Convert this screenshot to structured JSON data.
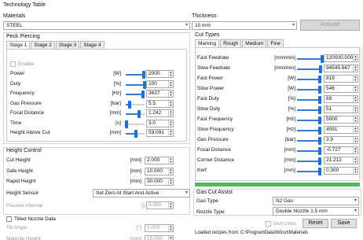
{
  "window_title": "Technology Table",
  "materials": {
    "label": "Materials",
    "value": "STEEL"
  },
  "thickness": {
    "label": "Thickness",
    "value": "10 mm",
    "activate_label": "Activate"
  },
  "peck": {
    "label": "Peck Piercing",
    "tabs": [
      "Stage 1",
      "Stage 2",
      "Stage 3",
      "Stage 4"
    ],
    "enable_label": "Enable",
    "params": [
      {
        "label": "Power",
        "unit": "[W]",
        "value": "2000",
        "level": 0.95
      },
      {
        "label": "Duty",
        "unit": "[%]",
        "value": "100",
        "level": 1.0
      },
      {
        "label": "Frequency",
        "unit": "[Hz]",
        "value": "3637",
        "level": 0.93
      },
      {
        "label": "Gas Pressure",
        "unit": "[bar]",
        "value": "5.5",
        "level": 0.22
      },
      {
        "label": "Focal Distance",
        "unit": "[mm]",
        "value": "1.242",
        "level": 0.7
      },
      {
        "label": "Time",
        "unit": "[s]",
        "value": "3.0",
        "level": 0.05
      },
      {
        "label": "Height Above Cut",
        "unit": "[mm]",
        "value": "59.091",
        "level": 0.55
      }
    ]
  },
  "cut_types": {
    "label": "Cut Types",
    "tabs": [
      "Marking",
      "Rough",
      "Medium",
      "Fine"
    ],
    "params": [
      {
        "label": "Fast Feedrate",
        "unit": "[mm/min]",
        "value": "120000.000",
        "level": 1.0
      },
      {
        "label": "Slow Feedrate",
        "unit": "[mm/min]",
        "value": "94545.667",
        "level": 0.95
      },
      {
        "label": "Fast Power",
        "unit": "[W]",
        "value": "819",
        "level": 0.9
      },
      {
        "label": "Slow Power",
        "unit": "[W]",
        "value": "546",
        "level": 0.9
      },
      {
        "label": "Fast Duty",
        "unit": "[%]",
        "value": "69",
        "level": 0.9
      },
      {
        "label": "Slow Duty",
        "unit": "[%]",
        "value": "51",
        "level": 0.9
      },
      {
        "label": "Fast Frequency",
        "unit": "[Hz]",
        "value": "5000",
        "level": 0.9
      },
      {
        "label": "Slow Frequency",
        "unit": "[Hz]",
        "value": "4091",
        "level": 0.9
      },
      {
        "label": "Gas Pressure",
        "unit": "[bar]",
        "value": "3.9",
        "level": 0.9
      },
      {
        "label": "Focal Distance",
        "unit": "[mm]",
        "value": "-0.727",
        "level": 0.9
      },
      {
        "label": "Corner Distance",
        "unit": "[mm]",
        "value": "21.212",
        "level": 0.9
      },
      {
        "label": "Kerf",
        "unit": "[mm]",
        "value": "0.300",
        "level": 0.9
      }
    ]
  },
  "height_control": {
    "label": "Height Control",
    "params": [
      {
        "label": "Cut Height",
        "unit": "[mm]",
        "value": "2.000"
      },
      {
        "label": "Safe Height",
        "unit": "[mm]",
        "value": "10.000"
      },
      {
        "label": "Rapid Height",
        "unit": "[mm]",
        "value": "30.000"
      }
    ],
    "sensor_label": "Height Sensor",
    "sensor_value": "Set Zero At Start And Active",
    "passive_label": "Passive Interval",
    "passive_unit": "[]",
    "passive_value": "0.000"
  },
  "tilted": {
    "label": "Tilted Nozzle Data",
    "params": [
      {
        "label": "Tilt Angle",
        "unit": "[°]",
        "value": "0.000"
      },
      {
        "label": "Material Height",
        "unit": "[mm]",
        "value": "10.000"
      }
    ]
  },
  "gas_assist": {
    "label": "Gas Cut Assist",
    "gas_type_label": "Gas Type",
    "gas_type_value": "N2 Gas",
    "nozzle_label": "Nozzle Type",
    "nozzle_value": "Double Nozzle 1.5 mm"
  },
  "footer": {
    "inch_units_label": "Inch Units",
    "reset_label": "Reset",
    "save_label": "Save",
    "status_text": "Loaded recipes from: C:\\ProgramData\\Wicut\\Materials"
  },
  "progress_level": 1.0,
  "colors": {
    "accent": "#1e6fd9",
    "progress": "#4cbb5a"
  }
}
